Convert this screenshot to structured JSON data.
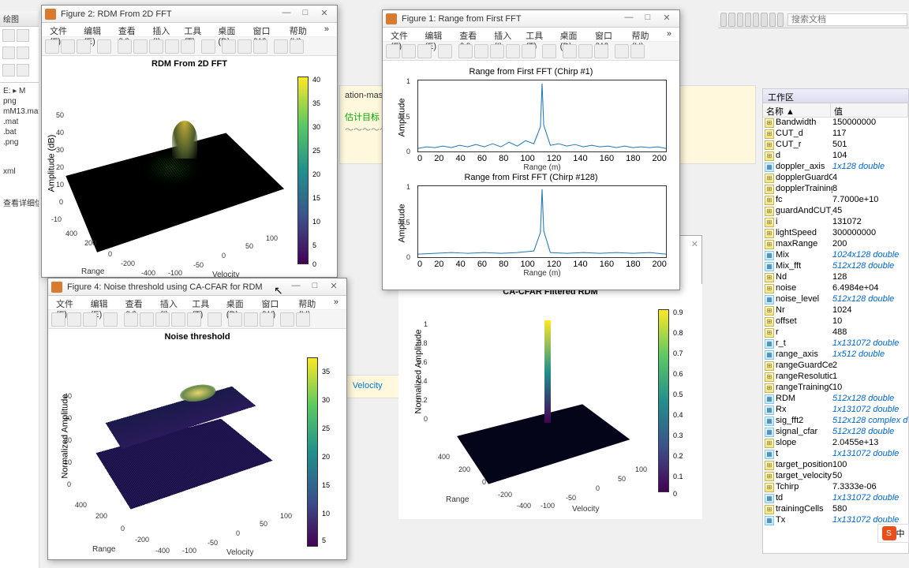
{
  "toolbar": {
    "search_placeholder": "搜索文档"
  },
  "leftstrip": {
    "tab": "绘图",
    "breadcrumb": "E: ▸ M",
    "files": [
      "png",
      "mM13.mat",
      ".mat",
      ".bat",
      ".png",
      "",
      "xml",
      "",
      "查看详细信息"
    ]
  },
  "menus": [
    "文件(F)",
    "编辑(E)",
    "查看(V)",
    "插入(I)",
    "工具(T)",
    "桌面(D)",
    "窗口(W)",
    "帮助(H)"
  ],
  "fig1": {
    "title": "Figure 1: Range from First FFT",
    "plot1_title": "Range from First FFT (Chirp #1)",
    "plot2_title": "Range from First FFT (Chirp #128)",
    "xlabel": "Range (m)",
    "ylabel": "Amplitude"
  },
  "fig2": {
    "title": "Figure 2: RDM From 2D FFT",
    "plot_title": "RDM From 2D FFT",
    "xlabel": "Velocity",
    "ylabel": "Range",
    "zlabel": "Amplitude (dB)"
  },
  "fig3": {
    "plot_title": "CA-CFAR Filtered RDM",
    "xlabel": "Velocity",
    "ylabel": "Range",
    "zlabel": "Normalized Amplitude"
  },
  "fig4": {
    "title": "Figure 4: Noise threshold using CA-CFAR for RDM",
    "plot_title": "Noise threshold",
    "xlabel": "Velocity",
    "ylabel": "Range",
    "zlabel": "Normalized Amplitude"
  },
  "bgpanel": {
    "line1": "估计目标",
    "line2": "Velocity"
  },
  "workspace": {
    "title": "工作区",
    "col_name": "名称 ▲",
    "col_value": "值",
    "vars": [
      {
        "n": "Bandwidth",
        "v": "150000000",
        "t": "s"
      },
      {
        "n": "CUT_d",
        "v": "117",
        "t": "s"
      },
      {
        "n": "CUT_r",
        "v": "501",
        "t": "s"
      },
      {
        "n": "d",
        "v": "104",
        "t": "s"
      },
      {
        "n": "doppler_axis",
        "v": "1x128 double",
        "t": "m"
      },
      {
        "n": "dopplerGuardC...",
        "v": "4",
        "t": "s"
      },
      {
        "n": "dopplerTraining...",
        "v": "8",
        "t": "s"
      },
      {
        "n": "fc",
        "v": "7.7000e+10",
        "t": "s"
      },
      {
        "n": "guardAndCUT_C...",
        "v": "45",
        "t": "s"
      },
      {
        "n": "i",
        "v": "131072",
        "t": "s"
      },
      {
        "n": "lightSpeed",
        "v": "300000000",
        "t": "s"
      },
      {
        "n": "maxRange",
        "v": "200",
        "t": "s"
      },
      {
        "n": "Mix",
        "v": "1024x128 double",
        "t": "m"
      },
      {
        "n": "Mix_fft",
        "v": "512x128 double",
        "t": "m"
      },
      {
        "n": "Nd",
        "v": "128",
        "t": "s"
      },
      {
        "n": "noise",
        "v": "6.4984e+04",
        "t": "s"
      },
      {
        "n": "noise_level",
        "v": "512x128 double",
        "t": "m"
      },
      {
        "n": "Nr",
        "v": "1024",
        "t": "s"
      },
      {
        "n": "offset",
        "v": "10",
        "t": "s"
      },
      {
        "n": "r",
        "v": "488",
        "t": "s"
      },
      {
        "n": "r_t",
        "v": "1x131072 double",
        "t": "m"
      },
      {
        "n": "range_axis",
        "v": "1x512 double",
        "t": "m"
      },
      {
        "n": "rangeGuardCells",
        "v": "2",
        "t": "s"
      },
      {
        "n": "rangeResolution",
        "v": "1",
        "t": "s"
      },
      {
        "n": "rangeTrainingCe...",
        "v": "10",
        "t": "s"
      },
      {
        "n": "RDM",
        "v": "512x128 double",
        "t": "m"
      },
      {
        "n": "Rx",
        "v": "1x131072 double",
        "t": "m"
      },
      {
        "n": "sig_fft2",
        "v": "512x128 complex d...",
        "t": "m"
      },
      {
        "n": "signal_cfar",
        "v": "512x128 double",
        "t": "m"
      },
      {
        "n": "slope",
        "v": "2.0455e+13",
        "t": "s"
      },
      {
        "n": "t",
        "v": "1x131072 double",
        "t": "m"
      },
      {
        "n": "target_position",
        "v": "100",
        "t": "s"
      },
      {
        "n": "target_velocity",
        "v": "50",
        "t": "s"
      },
      {
        "n": "Tchirp",
        "v": "7.3333e-06",
        "t": "s"
      },
      {
        "n": "td",
        "v": "1x131072 double",
        "t": "m"
      },
      {
        "n": "trainingCells",
        "v": "580",
        "t": "s"
      },
      {
        "n": "Tx",
        "v": "1x131072 double",
        "t": "m"
      }
    ]
  },
  "chart_data": [
    {
      "type": "surface3d",
      "title": "RDM From 2D FFT",
      "xlabel": "Velocity",
      "ylabel": "Range",
      "zlabel": "Amplitude (dB)",
      "xlim": [
        -100,
        100
      ],
      "ylim": [
        -400,
        400
      ],
      "zlim": [
        -10,
        50
      ],
      "xticks": [
        -100,
        -50,
        0,
        50,
        100
      ],
      "yticks": [
        -400,
        -200,
        0,
        200,
        400
      ],
      "zticks": [
        -10,
        0,
        10,
        20,
        30,
        40,
        50
      ],
      "colorbar_range": [
        0,
        40
      ],
      "colorbar_ticks": [
        0,
        5,
        10,
        15,
        20,
        25,
        30,
        35,
        40
      ],
      "peak": {
        "velocity": 50,
        "range": 100,
        "amplitude_db": 40
      }
    },
    {
      "type": "line",
      "title": "Range from First FFT (Chirp #1)",
      "xlabel": "Range (m)",
      "ylabel": "Amplitude",
      "xlim": [
        0,
        200
      ],
      "ylim": [
        0,
        1
      ],
      "xticks": [
        0,
        20,
        40,
        60,
        80,
        100,
        120,
        140,
        160,
        180,
        200
      ],
      "yticks": [
        0,
        0.5,
        1
      ],
      "peak_x": 100,
      "peak_y": 1.0
    },
    {
      "type": "line",
      "title": "Range from First FFT (Chirp #128)",
      "xlabel": "Range (m)",
      "ylabel": "Amplitude",
      "xlim": [
        0,
        200
      ],
      "ylim": [
        0,
        1
      ],
      "xticks": [
        0,
        20,
        40,
        60,
        80,
        100,
        120,
        140,
        160,
        180,
        200
      ],
      "yticks": [
        0,
        0.5,
        1
      ],
      "peak_x": 100,
      "peak_y": 1.0
    },
    {
      "type": "surface3d",
      "title": "CA-CFAR Filtered RDM",
      "xlabel": "Velocity",
      "ylabel": "Range",
      "zlabel": "Normalized Amplitude",
      "xlim": [
        -100,
        100
      ],
      "ylim": [
        -400,
        400
      ],
      "zlim": [
        0,
        1
      ],
      "zticks": [
        0,
        0.2,
        0.4,
        0.6,
        0.8,
        1
      ],
      "colorbar_range": [
        0,
        1
      ],
      "colorbar_ticks": [
        0,
        0.1,
        0.2,
        0.3,
        0.4,
        0.5,
        0.6,
        0.7,
        0.8,
        0.9
      ],
      "peak": {
        "velocity": 50,
        "range": 100,
        "amplitude": 1.0
      }
    },
    {
      "type": "surface3d",
      "title": "Noise threshold",
      "xlabel": "Velocity",
      "ylabel": "Range",
      "zlabel": "Normalized Amplitude",
      "xlim": [
        -100,
        100
      ],
      "ylim": [
        -400,
        400
      ],
      "zlim": [
        0,
        40
      ],
      "zticks": [
        0,
        10,
        20,
        30,
        40
      ],
      "colorbar_range": [
        5,
        35
      ],
      "colorbar_ticks": [
        5,
        10,
        15,
        20,
        25,
        30,
        35
      ],
      "peak": {
        "velocity": 50,
        "range": 100,
        "amplitude": 35
      }
    }
  ]
}
